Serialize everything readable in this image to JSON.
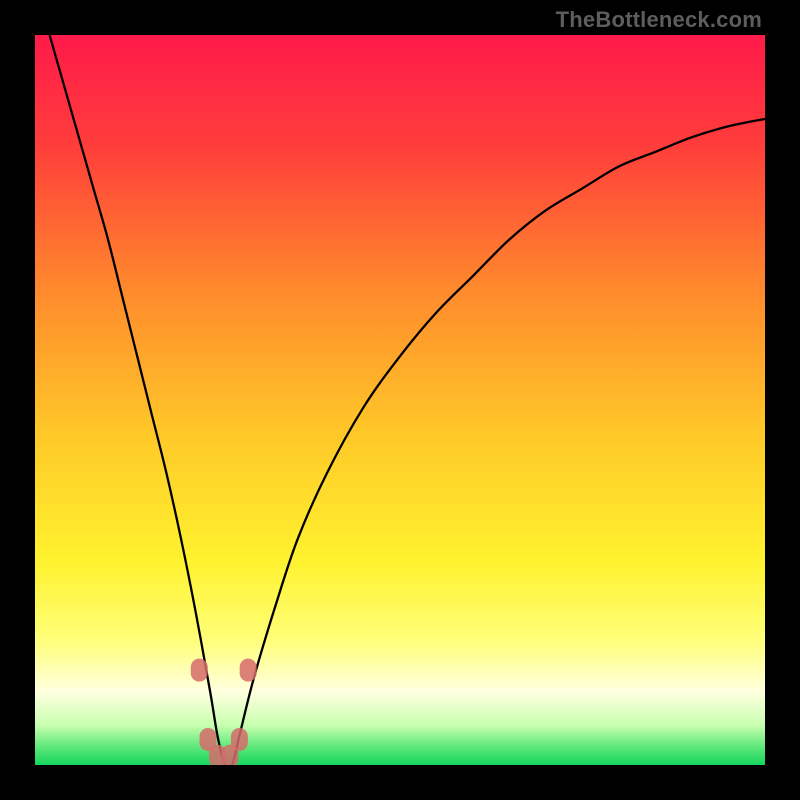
{
  "watermark": "TheBottleneck.com",
  "chart_data": {
    "type": "line",
    "title": "",
    "xlabel": "",
    "ylabel": "",
    "xlim": [
      0,
      100
    ],
    "ylim": [
      0,
      100
    ],
    "grid": false,
    "legend": false,
    "gradient_stops": [
      {
        "offset": 0.0,
        "color": "#ff1a4a"
      },
      {
        "offset": 0.15,
        "color": "#ff3d3b"
      },
      {
        "offset": 0.35,
        "color": "#ff8a2c"
      },
      {
        "offset": 0.55,
        "color": "#ffc928"
      },
      {
        "offset": 0.72,
        "color": "#fff22e"
      },
      {
        "offset": 0.83,
        "color": "#ffff7a"
      },
      {
        "offset": 0.9,
        "color": "#ffffe0"
      },
      {
        "offset": 0.945,
        "color": "#c9ffb0"
      },
      {
        "offset": 0.975,
        "color": "#5fe87a"
      },
      {
        "offset": 1.0,
        "color": "#17d65f"
      }
    ],
    "series": [
      {
        "name": "bottleneck-curve",
        "x": [
          2,
          4,
          6,
          8,
          10,
          12,
          14,
          16,
          18,
          20,
          22,
          24,
          25,
          26,
          27,
          28,
          30,
          33,
          36,
          40,
          45,
          50,
          55,
          60,
          65,
          70,
          75,
          80,
          85,
          90,
          95,
          100
        ],
        "y": [
          100,
          93,
          86,
          79,
          72,
          64,
          56,
          48,
          40,
          31,
          21,
          10,
          4,
          0,
          0,
          4,
          12,
          22,
          31,
          40,
          49,
          56,
          62,
          67,
          72,
          76,
          79,
          82,
          84,
          86,
          87.5,
          88.5
        ]
      }
    ],
    "markers": [
      {
        "x": 22.5,
        "y": 13
      },
      {
        "x": 29.2,
        "y": 13
      },
      {
        "x": 23.7,
        "y": 3.5
      },
      {
        "x": 28.0,
        "y": 3.5
      },
      {
        "x": 25.0,
        "y": 1.2
      },
      {
        "x": 26.7,
        "y": 1.2
      }
    ]
  }
}
